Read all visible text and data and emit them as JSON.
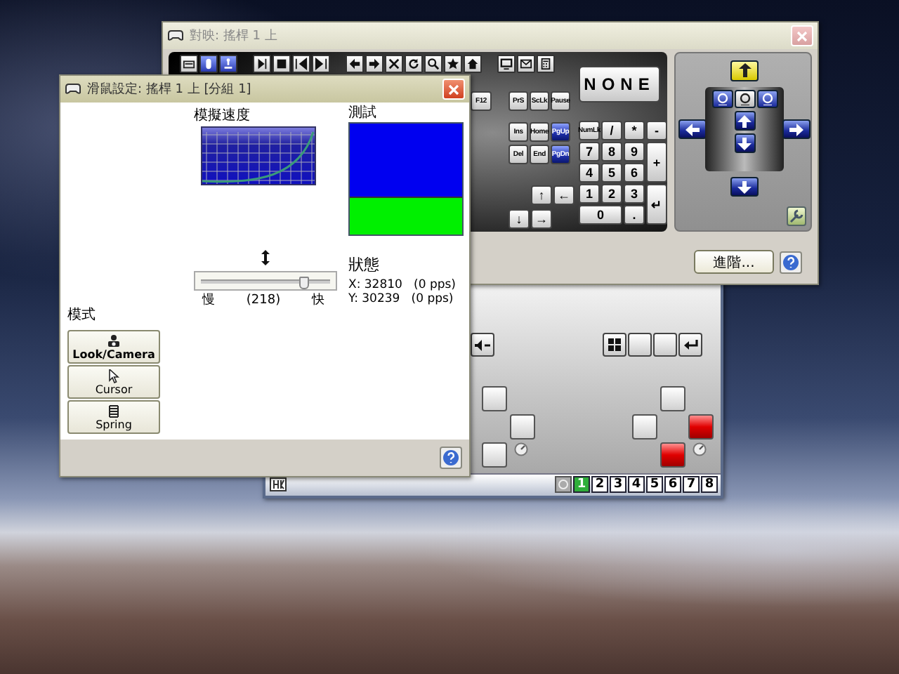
{
  "mapping_window": {
    "title": "對映: 搖桿 1 上",
    "toolbar": [
      {
        "kind": "keyboard",
        "selected": false
      },
      {
        "kind": "mouse",
        "selected": true
      },
      {
        "kind": "joystick",
        "selected": true
      },
      {
        "kind": "play",
        "selected": false
      },
      {
        "kind": "stop",
        "selected": false
      },
      {
        "kind": "previous",
        "selected": false
      },
      {
        "kind": "next",
        "selected": false
      },
      {
        "kind": "back",
        "selected": false
      },
      {
        "kind": "forward",
        "selected": false
      },
      {
        "kind": "cancel",
        "selected": false
      },
      {
        "kind": "refresh",
        "selected": false
      },
      {
        "kind": "search",
        "selected": false
      },
      {
        "kind": "star",
        "selected": false
      },
      {
        "kind": "home",
        "selected": false
      },
      {
        "kind": "monitor",
        "selected": false
      },
      {
        "kind": "mail",
        "selected": false
      },
      {
        "kind": "calculator",
        "selected": false
      }
    ],
    "function_keys": [
      {
        "label": "F12"
      }
    ],
    "system_keys": [
      {
        "label": "PrS"
      },
      {
        "label": "ScLk"
      },
      {
        "label": "Pause"
      }
    ],
    "edit_keys": [
      {
        "label": "Ins",
        "selected": false
      },
      {
        "label": "Home",
        "selected": false
      },
      {
        "label": "PgUp",
        "selected": true
      },
      {
        "label": "Del",
        "selected": false
      },
      {
        "label": "End",
        "selected": false
      },
      {
        "label": "PgDn",
        "selected": true
      }
    ],
    "arrow_keys": [
      "↑",
      "←",
      "↓",
      "→"
    ],
    "none_button": "NONE",
    "numpad": [
      {
        "label": "NumLk",
        "kind": "normal"
      },
      {
        "label": "/",
        "kind": "normal"
      },
      {
        "label": "*",
        "kind": "normal"
      },
      {
        "label": "-",
        "kind": "normal"
      },
      {
        "label": "7",
        "kind": "normal"
      },
      {
        "label": "8",
        "kind": "normal"
      },
      {
        "label": "9",
        "kind": "normal"
      },
      {
        "label": "+",
        "kind": "tall"
      },
      {
        "label": "4",
        "kind": "normal"
      },
      {
        "label": "5",
        "kind": "normal"
      },
      {
        "label": "6",
        "kind": "normal"
      },
      {
        "label": "1",
        "kind": "normal"
      },
      {
        "label": "2",
        "kind": "normal"
      },
      {
        "label": "3",
        "kind": "normal"
      },
      {
        "label": "↵",
        "kind": "tall"
      },
      {
        "label": "0",
        "kind": "wide"
      },
      {
        "label": ".",
        "kind": "normal"
      }
    ],
    "advanced_button": "進階..."
  },
  "controller_window": {
    "pads": [
      {
        "keys": [
          {
            "kind": "up",
            "highlighted": false
          },
          {
            "kind": "right",
            "highlighted": false
          },
          {
            "kind": "down",
            "highlighted": false
          }
        ]
      },
      {
        "keys": [
          {
            "kind": "up",
            "highlighted": false
          },
          {
            "kind": "left",
            "highlighted": false
          },
          {
            "kind": "right",
            "highlighted": true
          },
          {
            "kind": "down",
            "highlighted": true
          }
        ]
      }
    ],
    "pages": [
      {
        "label": "1",
        "selected": true
      },
      {
        "label": "2",
        "selected": false
      },
      {
        "label": "3",
        "selected": false
      },
      {
        "label": "4",
        "selected": false
      },
      {
        "label": "5",
        "selected": false
      },
      {
        "label": "6",
        "selected": false
      },
      {
        "label": "7",
        "selected": false
      },
      {
        "label": "8",
        "selected": false
      }
    ]
  },
  "mouse_window": {
    "title": "滑鼠設定: 搖桿 1 上 [分組 1]",
    "speed_label": "模擬速度",
    "test_label": "測試",
    "slider": {
      "level": 0.8
    },
    "slow_label": "慢",
    "speed_value": "(218)",
    "fast_label": "快",
    "status_label": "狀態",
    "status_lines": [
      "X: 32810   (0 pps)",
      "Y: 30239   (0 pps)"
    ],
    "mode_label": "模式",
    "modes": [
      {
        "label": "Look/Camera",
        "kind": "camera",
        "selected": true
      },
      {
        "label": "Cursor",
        "kind": "cursor",
        "selected": false
      },
      {
        "label": "Spring",
        "kind": "spring",
        "selected": false
      }
    ]
  }
}
